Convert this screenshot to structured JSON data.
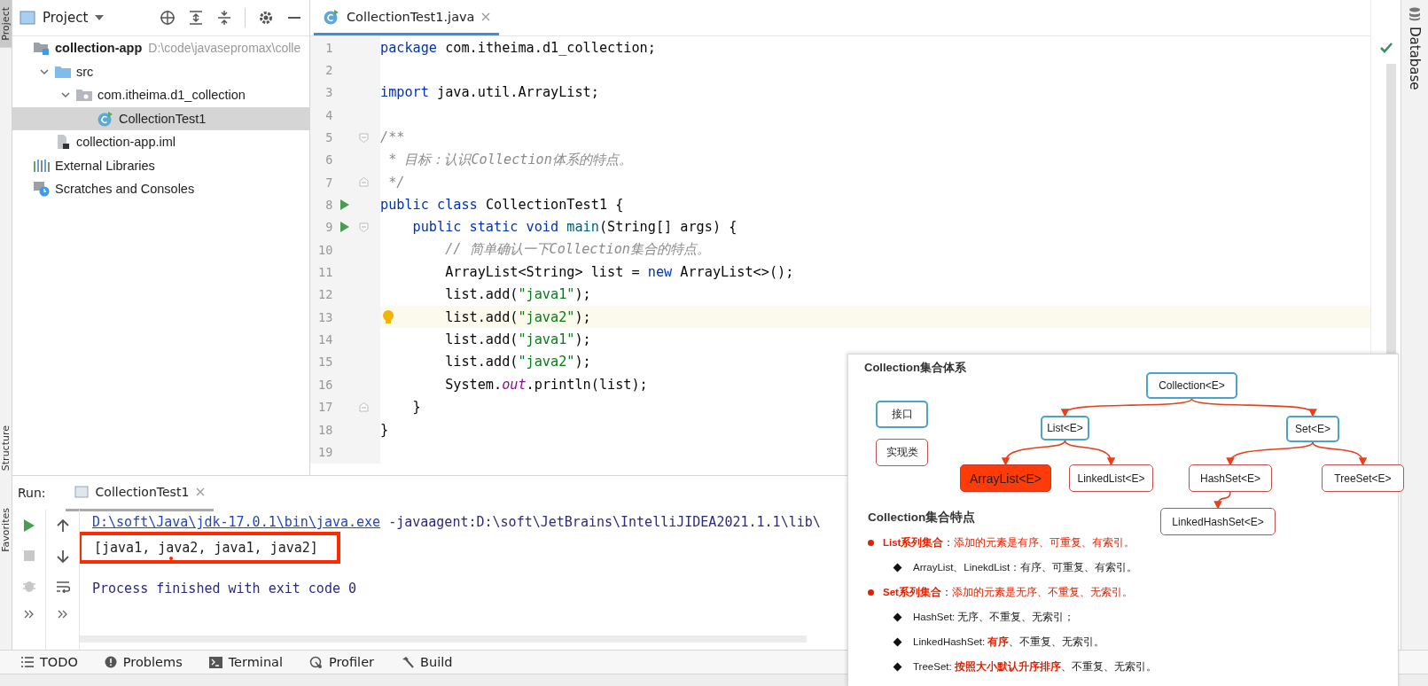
{
  "left_strip": {
    "labels": [
      {
        "label": "Project",
        "selected": true
      },
      {
        "label": "Structure",
        "selected": false
      },
      {
        "label": "Favorites",
        "selected": false
      }
    ]
  },
  "project_panel": {
    "title": "Project",
    "tree": [
      {
        "label": "collection-app",
        "path": "D:\\code\\javasepromax\\colle",
        "kind": "module",
        "selected": false,
        "children": [
          {
            "label": "src",
            "kind": "folder",
            "expanded": true,
            "selected": false,
            "children": [
              {
                "label": "com.itheima.d1_collection",
                "kind": "package",
                "expanded": true,
                "selected": false,
                "children": [
                  {
                    "label": "CollectionTest1",
                    "kind": "class",
                    "selected": true
                  }
                ]
              }
            ]
          },
          {
            "label": "collection-app.iml",
            "kind": "module_file",
            "selected": false
          }
        ]
      },
      {
        "label": "External Libraries",
        "kind": "libraries",
        "selected": false
      },
      {
        "label": "Scratches and Consoles",
        "kind": "scratches",
        "selected": false
      }
    ]
  },
  "editor": {
    "tab": {
      "label": "CollectionTest1.java",
      "selected": true
    },
    "lines": [
      {
        "number": "1",
        "current": false,
        "tokens": [
          {
            "kind": "keyword",
            "text": "package"
          },
          {
            "kind": "plain",
            "text": " com.itheima.d1_collection;"
          }
        ]
      },
      {
        "number": "2",
        "current": false
      },
      {
        "number": "3",
        "current": false,
        "tokens": [
          {
            "kind": "keyword",
            "text": "import"
          },
          {
            "kind": "plain",
            "text": " java.util.ArrayList;"
          }
        ]
      },
      {
        "number": "4",
        "current": false
      },
      {
        "number": "5",
        "current": false,
        "fold_start": true,
        "tokens": [
          {
            "kind": "comment",
            "text": "/**"
          }
        ]
      },
      {
        "number": "6",
        "current": false,
        "tokens": [
          {
            "kind": "comment",
            "text": " * 目标：认识Collection体系的特点。"
          }
        ]
      },
      {
        "number": "7",
        "current": false,
        "fold_end": true,
        "tokens": [
          {
            "kind": "comment",
            "text": " */"
          }
        ]
      },
      {
        "number": "8",
        "current": false,
        "runnable": true,
        "tokens": [
          {
            "kind": "keyword",
            "text": "public class"
          },
          {
            "kind": "plain",
            "text": " CollectionTest1 {"
          }
        ]
      },
      {
        "number": "9",
        "current": false,
        "runnable": true,
        "fold_start": true,
        "tokens": [
          {
            "kind": "keyword",
            "text": "    public static void"
          },
          {
            "kind": "method",
            "text": " main"
          },
          {
            "kind": "plain",
            "text": "(String[] args) {"
          }
        ]
      },
      {
        "number": "10",
        "current": false,
        "tokens": [
          {
            "kind": "comment",
            "text": "        // 简单确认一下Collection集合的特点。"
          }
        ]
      },
      {
        "number": "11",
        "current": false,
        "tokens": [
          {
            "kind": "plain",
            "text": "        ArrayList<String> list = "
          },
          {
            "kind": "keyword",
            "text": "new"
          },
          {
            "kind": "plain",
            "text": " ArrayList<>();"
          }
        ]
      },
      {
        "number": "12",
        "current": false,
        "tokens": [
          {
            "kind": "plain",
            "text": "        list.add("
          },
          {
            "kind": "string",
            "text": "\"java1\""
          },
          {
            "kind": "plain",
            "text": ");"
          }
        ]
      },
      {
        "number": "13",
        "current": true,
        "intention": true,
        "tokens": [
          {
            "kind": "plain",
            "text": "        list.add("
          },
          {
            "kind": "string",
            "text": "\"java2\""
          },
          {
            "kind": "plain",
            "text": ");"
          }
        ]
      },
      {
        "number": "14",
        "current": false,
        "tokens": [
          {
            "kind": "plain",
            "text": "        list.add("
          },
          {
            "kind": "string",
            "text": "\"java1\""
          },
          {
            "kind": "plain",
            "text": ");"
          }
        ]
      },
      {
        "number": "15",
        "current": false,
        "tokens": [
          {
            "kind": "plain",
            "text": "        list.add("
          },
          {
            "kind": "string",
            "text": "\"java2\""
          },
          {
            "kind": "plain",
            "text": ");"
          }
        ]
      },
      {
        "number": "16",
        "current": false,
        "tokens": [
          {
            "kind": "plain",
            "text": "        System."
          },
          {
            "kind": "field",
            "text": "out"
          },
          {
            "kind": "plain",
            "text": ".println(list);"
          }
        ]
      },
      {
        "number": "17",
        "current": false,
        "fold_end": true,
        "tokens": [
          {
            "kind": "plain",
            "text": "    }"
          }
        ]
      },
      {
        "number": "18",
        "current": false,
        "tokens": [
          {
            "kind": "plain",
            "text": "}"
          }
        ]
      },
      {
        "number": "19",
        "current": false
      }
    ]
  },
  "right_strip": {
    "label": "Database"
  },
  "run_panel": {
    "label": "Run:",
    "tab": {
      "label": "CollectionTest1",
      "selected": true
    },
    "output": [
      {
        "kind": "command",
        "link": "D:\\soft\\Java\\jdk-17.0.1\\bin\\java.exe",
        "text": " -javaagent:D:\\soft\\JetBrains\\IntelliJIDEA2021.1.1\\lib\\"
      },
      {
        "kind": "result",
        "text": "[java1, java2, java1, java2]",
        "highlighted": true
      },
      {
        "kind": "system",
        "text": "Process finished with exit code 0"
      }
    ]
  },
  "tool_windows": [
    {
      "label": "TODO",
      "kind": "todo"
    },
    {
      "label": "Problems",
      "kind": "problems"
    },
    {
      "label": "Terminal",
      "kind": "terminal"
    },
    {
      "label": "Profiler",
      "kind": "profiler"
    },
    {
      "label": "Build",
      "kind": "build"
    }
  ],
  "slide": {
    "title": "Collection集合体系",
    "legend": [
      {
        "label": "接口",
        "kind": "interface"
      },
      {
        "label": "实现类",
        "kind": "implementation"
      }
    ],
    "tree": {
      "label": "Collection<E>",
      "kind": "interface",
      "children": [
        {
          "label": "List<E>",
          "kind": "interface",
          "children": [
            {
              "label": "ArrayList<E>",
              "kind": "highlighted"
            },
            {
              "label": "LinkedList<E>",
              "kind": "implementation"
            }
          ]
        },
        {
          "label": "Set<E>",
          "kind": "interface",
          "children": [
            {
              "label": "HashSet<E>",
              "kind": "implementation",
              "children": [
                {
                  "label": "LinkedHashSet<E>",
                  "kind": "implementation"
                }
              ]
            },
            {
              "label": "TreeSet<E>",
              "kind": "implementation"
            }
          ]
        }
      ]
    },
    "subtitle": "Collection集合特点",
    "points": [
      {
        "segments": [
          {
            "kind": "strong",
            "text": "List系列集合"
          },
          {
            "kind": "plain",
            "text": "："
          },
          {
            "kind": "accent",
            "text": "添加的元素是有序、可重复、有索引。"
          }
        ],
        "children": [
          {
            "segments": [
              {
                "kind": "plain",
                "text": "ArrayList、LinekdList：有序、可重复、有索引。"
              }
            ]
          }
        ]
      },
      {
        "segments": [
          {
            "kind": "strong",
            "text": "Set系列集合"
          },
          {
            "kind": "plain",
            "text": "："
          },
          {
            "kind": "accent",
            "text": "添加的元素是无序、不重复、无索引。"
          }
        ],
        "children": [
          {
            "segments": [
              {
                "kind": "plain",
                "text": "HashSet: 无序、不重复、无索引；"
              }
            ]
          },
          {
            "segments": [
              {
                "kind": "plain",
                "text": "LinkedHashSet: "
              },
              {
                "kind": "strong",
                "text": "有序"
              },
              {
                "kind": "plain",
                "text": "、不重复、无索引。"
              }
            ]
          },
          {
            "segments": [
              {
                "kind": "plain",
                "text": "TreeSet: "
              },
              {
                "kind": "strong",
                "text": "按照大小默认升序排序"
              },
              {
                "kind": "plain",
                "text": "、不重复、无索引。"
              }
            ]
          }
        ]
      }
    ]
  }
}
